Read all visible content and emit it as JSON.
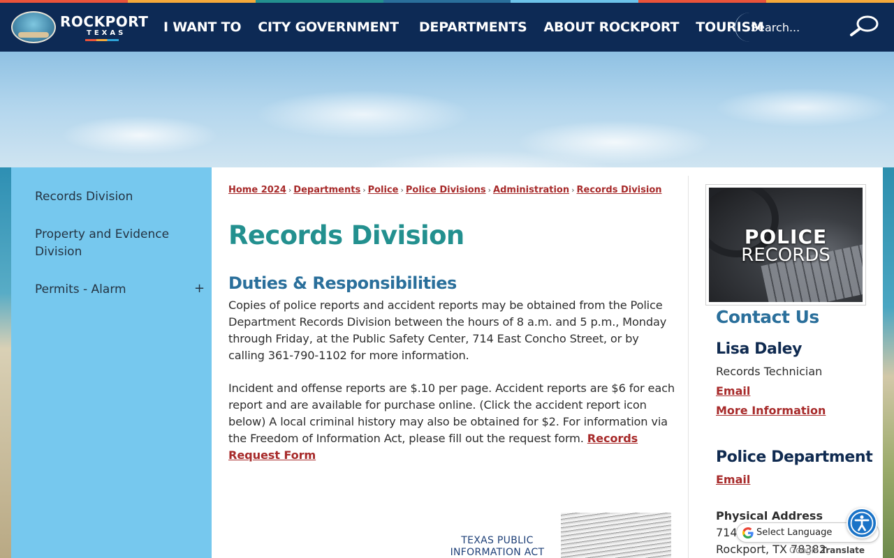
{
  "colors": {
    "stripe": [
      "#e9533a",
      "#f4a93a",
      "#23908f",
      "#2a6f9b",
      "#6cc3ea",
      "#e9533a",
      "#f4a93a"
    ],
    "header_bg": "#0d2a55",
    "sidebar_bg": "#76c8ee",
    "title_teal": "#23908f",
    "heading_blue": "#2a6f9b",
    "link_red": "#a72a2a",
    "name_navy": "#0f2a50"
  },
  "header": {
    "logo_word": "ROCKPORT",
    "logo_sub": "TEXAS",
    "nav": [
      "I WANT TO",
      "CITY GOVERNMENT",
      "DEPARTMENTS",
      "ABOUT ROCKPORT",
      "TOURISM"
    ],
    "search_placeholder": "Search...",
    "search_icon": "magnifier-icon"
  },
  "sidebar": {
    "items": [
      {
        "label": "Records Division"
      },
      {
        "label": "Property and Evidence Division"
      },
      {
        "label": "Permits - Alarm",
        "expand": "+"
      }
    ]
  },
  "main": {
    "breadcrumbs": [
      "Home 2024",
      "Departments",
      "Police",
      "Police Divisions",
      "Administration",
      "Records Division"
    ],
    "breadcrumb_sep": "›",
    "title": "Records Division",
    "section_heading": "Duties & Responsibilities",
    "para1": "Copies of police reports and accident reports may be obtained from the Police Department Records Division between the hours of 8 a.m. and 5 p.m., Monday through Friday, at the Public Safety Center, 714 East Concho Street, or by calling 361-790-1102 for more information.",
    "para2": "Incident and offense reports are $.10 per page. Accident reports are $6 for each report and are available for purchase online. (Click the accident report icon below) A local criminal history may also be obtained for $2. For information via the Freedom of Information Act, please fill out the request form.",
    "para2_link": "Records Request Form",
    "tpia_line1": "TEXAS PUBLIC",
    "tpia_line2": "INFORMATION ACT"
  },
  "aside": {
    "image_line1": "POLICE",
    "image_line2": "RECORDS",
    "contact_title": "Contact Us",
    "person_name": "Lisa Daley",
    "person_role": "Records Technician",
    "email_label": "Email",
    "more_info_label": "More Information",
    "dept_title": "Police Department",
    "dept_email_label": "Email",
    "address_label": "Physical Address",
    "address_line1": "714",
    "address_line2": "Rockport, TX 78382"
  },
  "widgets": {
    "translate_label": "Select Language",
    "powered_by": "Translate",
    "google_word": "Google",
    "accessibility_icon": "accessibility-icon"
  }
}
